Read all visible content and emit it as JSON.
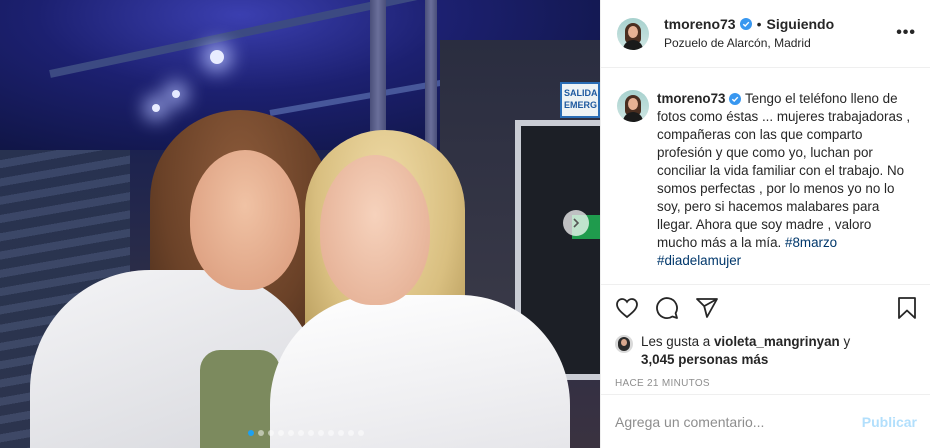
{
  "post": {
    "username": "tmoreno73",
    "follow_separator": "•",
    "follow_status": "Siguiendo",
    "location": "Pozuelo de Alarcón, Madrid",
    "more_label": "•••",
    "caption": "Tengo el teléfono lleno de fotos como éstas ... mujeres trabajadoras , compañeras con las que comparto profesión y que como yo, luchan por conciliar la vida familiar con el trabajo. No somos perfectas , por lo menos yo no lo soy, pero si hacemos malabares para llegar. Ahora que soy madre , valoro mucho más a la mía.",
    "hashtags": [
      "#8marzo",
      "#diadelamujer"
    ],
    "likes_prefix": "Les gusta a ",
    "liked_by": "violeta_mangrinyan",
    "likes_conjunction": " y",
    "likes_others": "3,045 personas más",
    "time_ago": "HACE 21 MINUTOS"
  },
  "photo": {
    "exit_sign_text": "SALIDA EMERG",
    "carousel_dots": 12,
    "active_dot": 0
  },
  "comment_form": {
    "placeholder": "Agrega un comentario...",
    "publish_label": "Publicar"
  },
  "colors": {
    "verified": "#3897f0",
    "hashtag": "#00376b",
    "publish_disabled": "#b2dffc",
    "meta_gray": "#8e8e8e"
  },
  "icons": [
    "more-icon",
    "heart-icon",
    "comment-icon",
    "share-icon",
    "bookmark-icon",
    "verified-icon",
    "chevron-right-icon"
  ]
}
